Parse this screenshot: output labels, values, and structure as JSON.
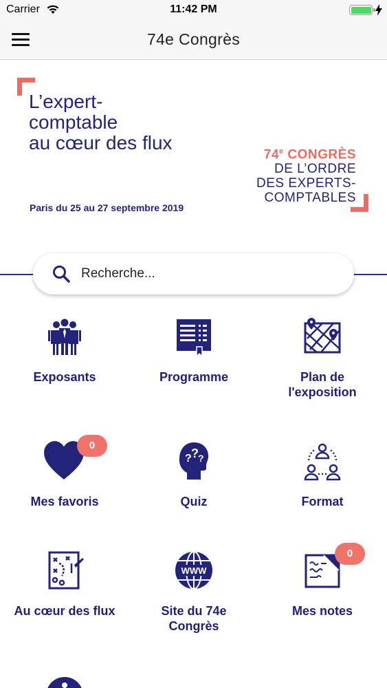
{
  "status_bar": {
    "carrier": "Carrier",
    "time": "11:42 PM",
    "battery_level": 1.0
  },
  "nav": {
    "title": "74e Congrès",
    "menu_icon": "hamburger-icon"
  },
  "banner": {
    "tagline": [
      "L’expert-",
      "comptable",
      "au cœur des flux"
    ],
    "dates": "Paris du 25 au 27 septembre 2019",
    "congres_number": "74",
    "congres_sup": "e",
    "congres_word": "CONGRÈS",
    "congres_lines": [
      "DE L’ORDRE",
      "DES EXPERTS-",
      "COMPTABLES"
    ],
    "accent_color": "#ef6a61",
    "brand_color": "#23237a"
  },
  "search": {
    "placeholder": "Recherche..."
  },
  "grid": {
    "items": [
      {
        "label": "Exposants",
        "icon": "people-icon"
      },
      {
        "label": "Programme",
        "icon": "program-book-icon"
      },
      {
        "label": "Plan de\nl'exposition",
        "icon": "map-icon"
      },
      {
        "label": "Mes favoris",
        "icon": "heart-icon",
        "badge": "0"
      },
      {
        "label": "Quiz",
        "icon": "quiz-head-icon"
      },
      {
        "label": "Format",
        "icon": "group-icon"
      },
      {
        "label": "Au cœur des flux",
        "icon": "strategy-icon"
      },
      {
        "label": "Site du 74e\nCongrès",
        "icon": "www-globe-icon"
      },
      {
        "label": "Mes notes",
        "icon": "notes-icon",
        "badge": "0"
      },
      {
        "label": "",
        "icon": "info-icon"
      }
    ]
  }
}
